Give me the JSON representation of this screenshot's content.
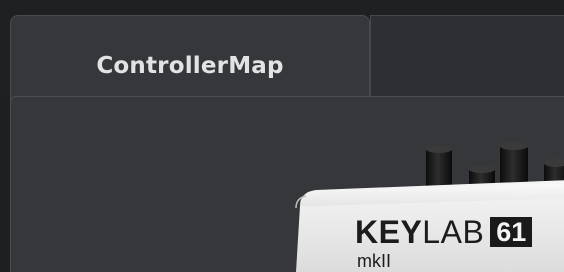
{
  "tabs": [
    {
      "label": "ControllerMap",
      "active": true
    },
    {
      "label": "",
      "active": false
    }
  ],
  "device": {
    "brand_bold": "KEY",
    "brand_light": "LAB",
    "model": "61",
    "variant": "mkII"
  },
  "colors": {
    "background": "#1e1f21",
    "tab_active": "#35373b",
    "panel": "#35373b",
    "tab_text": "#e2e3e5",
    "device_body": "#ececec"
  }
}
